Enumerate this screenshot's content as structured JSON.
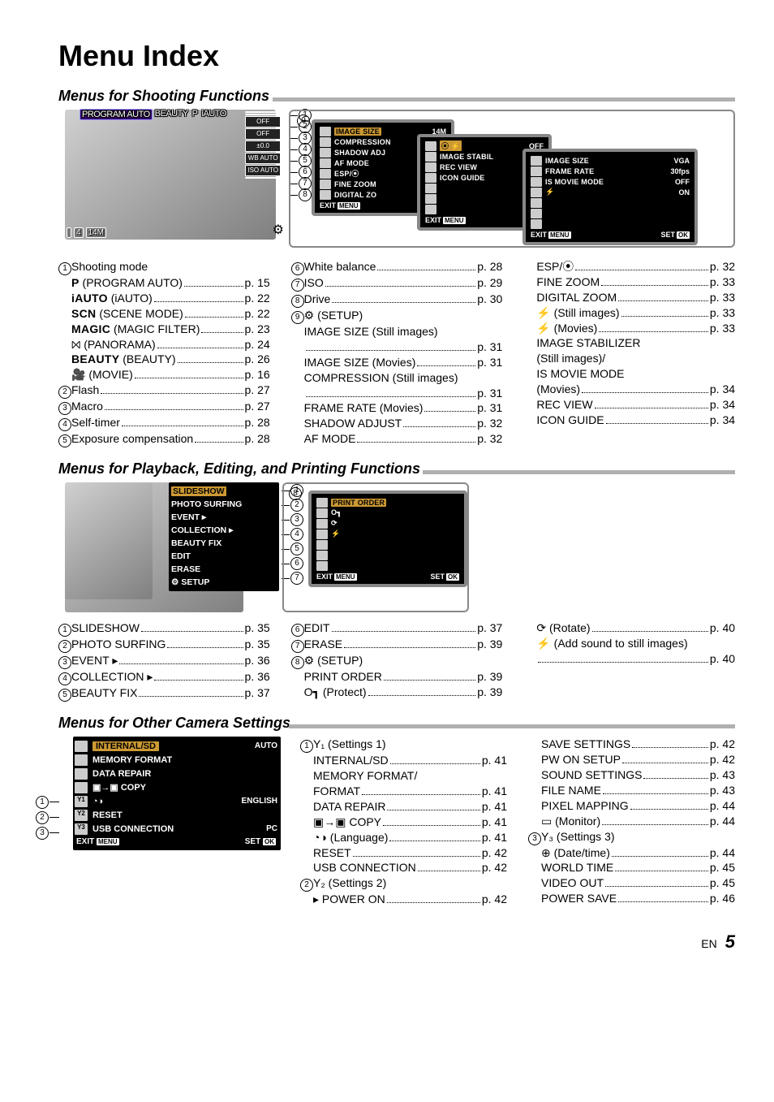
{
  "page": {
    "title": "Menu Index",
    "lang": "EN",
    "number": "5"
  },
  "sec1": {
    "title": "Menus for Shooting Functions",
    "modeBar": [
      "PROGRAM AUTO",
      "BEAUTY",
      "P",
      "iAUTO"
    ],
    "rightChips": [
      "",
      "",
      "OFF",
      "OFF",
      "±0.0",
      "WB AUTO",
      "ISO AUTO",
      ""
    ],
    "bottomChips": [
      "",
      "4",
      "14M"
    ],
    "panels": {
      "p1": {
        "rows": [
          [
            "IMAGE SIZE",
            "14M",
            true
          ],
          [
            "COMPRESSION",
            ""
          ],
          [
            "SHADOW ADJ",
            ""
          ],
          [
            "AF MODE",
            ""
          ],
          [
            "ESP/⦿",
            ""
          ],
          [
            "FINE ZOOM",
            ""
          ],
          [
            "DIGITAL ZO",
            ""
          ]
        ],
        "footL": "EXIT",
        "footLk": "MENU"
      },
      "p2": {
        "rows": [
          [
            "⦿ ⚡",
            "OFF",
            true
          ],
          [
            "IMAGE STABIL",
            ""
          ],
          [
            "REC VIEW",
            ""
          ],
          [
            "ICON GUIDE",
            ""
          ],
          [
            "",
            ""
          ],
          [
            "",
            ""
          ],
          [
            "",
            ""
          ]
        ],
        "footL": "EXIT",
        "footLk": "MENU"
      },
      "p3": {
        "rows": [
          [
            "IMAGE SIZE",
            "VGA"
          ],
          [
            "FRAME RATE",
            "30fps"
          ],
          [
            "IS MOVIE MODE",
            "OFF"
          ],
          [
            "⚡",
            "ON"
          ],
          [
            "",
            ""
          ],
          [
            "",
            ""
          ],
          [
            "",
            ""
          ]
        ],
        "footL": "EXIT",
        "footLk": "MENU",
        "footR": "SET",
        "footRk": "OK"
      }
    },
    "col1": [
      {
        "circ": "1",
        "label": "Shooting mode",
        "noPage": true
      },
      {
        "sub": true,
        "strong": "P",
        "label": " (PROGRAM AUTO)",
        "pg": "p. 15"
      },
      {
        "sub": true,
        "strong": "iAUTO",
        "label": " (iAUTO)",
        "pg": "p. 22"
      },
      {
        "sub": true,
        "strong": "SCN",
        "label": " (SCENE MODE)",
        "pg": "p. 22"
      },
      {
        "sub": true,
        "strong": "MAGIC",
        "label": " (MAGIC FILTER)",
        "pg": "p. 23"
      },
      {
        "sub": true,
        "label": "⨝ (PANORAMA)",
        "pg": "p. 24"
      },
      {
        "sub": true,
        "strong": "BEAUTY",
        "label": " (BEAUTY)",
        "pg": "p. 26"
      },
      {
        "sub": true,
        "label": "🎥 (MOVIE)",
        "pg": "p. 16"
      },
      {
        "circ": "2",
        "label": "Flash",
        "pg": "p. 27"
      },
      {
        "circ": "3",
        "label": "Macro",
        "pg": "p. 27"
      },
      {
        "circ": "4",
        "label": "Self-timer",
        "pg": "p. 28"
      },
      {
        "circ": "5",
        "label": "Exposure compensation",
        "pg": "p. 28"
      }
    ],
    "col2": [
      {
        "circ": "6",
        "label": "White balance",
        "pg": "p. 28"
      },
      {
        "circ": "7",
        "label": "ISO",
        "pg": "p. 29"
      },
      {
        "circ": "8",
        "label": "Drive",
        "pg": "p. 30"
      },
      {
        "circ": "9",
        "label": "⚙ (SETUP)",
        "noPage": true
      },
      {
        "sub": true,
        "label": "IMAGE SIZE (Still images)",
        "noPage": true
      },
      {
        "sub": true,
        "label": "",
        "pg": "p. 31"
      },
      {
        "sub": true,
        "label": "IMAGE SIZE (Movies)",
        "pg": "p. 31"
      },
      {
        "sub": true,
        "label": "COMPRESSION (Still images)",
        "noPage": true
      },
      {
        "sub": true,
        "label": "",
        "pg": "p. 31"
      },
      {
        "sub": true,
        "label": "FRAME RATE (Movies)",
        "pg": "p. 31"
      },
      {
        "sub": true,
        "label": "SHADOW ADJUST",
        "pg": "p. 32"
      },
      {
        "sub": true,
        "label": "AF MODE",
        "pg": "p. 32"
      }
    ],
    "col3": [
      {
        "sub": true,
        "label": "ESP/⦿",
        "pg": "p. 32"
      },
      {
        "sub": true,
        "label": "FINE ZOOM",
        "pg": "p. 33"
      },
      {
        "sub": true,
        "label": "DIGITAL ZOOM",
        "pg": "p. 33"
      },
      {
        "sub": true,
        "label": "⚡ (Still images)",
        "pg": "p. 33"
      },
      {
        "sub": true,
        "label": "⚡ (Movies)",
        "pg": "p. 33"
      },
      {
        "sub": true,
        "label": "IMAGE STABILIZER",
        "noPage": true
      },
      {
        "sub": true,
        "label": "(Still images)/",
        "noPage": true
      },
      {
        "sub": true,
        "label": "IS MOVIE MODE",
        "noPage": true
      },
      {
        "sub": true,
        "label": "(Movies)",
        "pg": "p. 34"
      },
      {
        "sub": true,
        "label": "REC VIEW",
        "pg": "p. 34"
      },
      {
        "sub": true,
        "label": "ICON GUIDE",
        "pg": "p. 34"
      }
    ]
  },
  "sec2": {
    "title": "Menus for Playback, Editing, and Printing Functions",
    "overlay": [
      [
        "SLIDESHOW",
        true
      ],
      [
        "PHOTO SURFING"
      ],
      [
        "EVENT ▸"
      ],
      [
        "COLLECTION ▸"
      ],
      [
        "BEAUTY FIX"
      ],
      [
        "EDIT"
      ],
      [
        "ERASE"
      ],
      [
        "⚙ SETUP"
      ]
    ],
    "panel": {
      "rows": [
        [
          "PRINT ORDER",
          true
        ],
        [
          "O┓"
        ],
        [
          "⟳"
        ],
        [
          "⚡"
        ],
        [
          ""
        ],
        [
          ""
        ],
        [
          ""
        ]
      ],
      "footL": "EXIT",
      "footLk": "MENU",
      "footR": "SET",
      "footRk": "OK"
    },
    "col1": [
      {
        "circ": "1",
        "label": "SLIDESHOW",
        "pg": "p. 35"
      },
      {
        "circ": "2",
        "label": "PHOTO SURFING",
        "pg": "p. 35"
      },
      {
        "circ": "3",
        "label": "EVENT ▸",
        "pg": "p. 36"
      },
      {
        "circ": "4",
        "label": "COLLECTION ▸",
        "pg": "p. 36"
      },
      {
        "circ": "5",
        "label": "BEAUTY FIX",
        "pg": "p. 37"
      }
    ],
    "col2": [
      {
        "circ": "6",
        "label": "EDIT",
        "pg": "p. 37"
      },
      {
        "circ": "7",
        "label": "ERASE",
        "pg": "p. 39"
      },
      {
        "circ": "8",
        "label": "⚙ (SETUP)",
        "noPage": true
      },
      {
        "sub": true,
        "label": "PRINT ORDER",
        "pg": "p. 39"
      },
      {
        "sub": true,
        "label": "O┓ (Protect)",
        "pg": "p. 39"
      }
    ],
    "col3": [
      {
        "sub": true,
        "label": "⟳ (Rotate)",
        "pg": "p. 40"
      },
      {
        "sub": true,
        "label": "⚡ (Add sound to still images)",
        "noPage": true
      },
      {
        "sub": true,
        "label": "",
        "pg": "p. 40"
      }
    ]
  },
  "sec3": {
    "title": "Menus for Other Camera Settings",
    "panel": {
      "rows": [
        [
          "",
          "INTERNAL/SD",
          "AUTO",
          true
        ],
        [
          "",
          "MEMORY FORMAT",
          ""
        ],
        [
          "",
          "DATA REPAIR",
          ""
        ],
        [
          "",
          "▣→▣ COPY",
          ""
        ],
        [
          "Y1",
          "◔◑",
          "ENGLISH"
        ],
        [
          "Y2",
          "RESET",
          ""
        ],
        [
          "Y3",
          "USB CONNECTION",
          "PC"
        ]
      ],
      "footL": "EXIT",
      "footLk": "MENU",
      "footR": "SET",
      "footRk": "OK"
    },
    "col1": [
      {
        "circ": "1",
        "label": "Y₁ (Settings 1)",
        "noPage": true
      },
      {
        "sub": true,
        "label": "INTERNAL/SD",
        "pg": "p. 41"
      },
      {
        "sub": true,
        "label": "MEMORY FORMAT/",
        "noPage": true
      },
      {
        "sub": true,
        "label": "FORMAT",
        "pg": "p. 41"
      },
      {
        "sub": true,
        "label": "DATA REPAIR",
        "pg": "p. 41"
      },
      {
        "sub": true,
        "label": "▣→▣ COPY",
        "pg": "p. 41"
      },
      {
        "sub": true,
        "label": "◔◑ (Language)",
        "pg": "p. 41"
      },
      {
        "sub": true,
        "label": "RESET",
        "pg": "p. 42"
      },
      {
        "sub": true,
        "label": "USB CONNECTION",
        "pg": "p. 42"
      },
      {
        "circ": "2",
        "label": "Y₂ (Settings 2)",
        "noPage": true
      },
      {
        "sub": true,
        "label": "▸ POWER ON",
        "pg": "p. 42"
      }
    ],
    "col2": [
      {
        "sub": true,
        "label": "SAVE SETTINGS",
        "pg": "p. 42"
      },
      {
        "sub": true,
        "label": "PW ON SETUP",
        "pg": "p. 42"
      },
      {
        "sub": true,
        "label": "SOUND SETTINGS",
        "pg": "p. 43"
      },
      {
        "sub": true,
        "label": "FILE NAME",
        "pg": "p. 43"
      },
      {
        "sub": true,
        "label": "PIXEL MAPPING",
        "pg": "p. 44"
      },
      {
        "sub": true,
        "label": "▭ (Monitor)",
        "pg": "p. 44"
      },
      {
        "circ": "3",
        "label": "Y₃ (Settings 3)",
        "noPage": true
      },
      {
        "sub": true,
        "label": "⊕ (Date/time)",
        "pg": "p. 44"
      },
      {
        "sub": true,
        "label": "WORLD TIME",
        "pg": "p. 45"
      },
      {
        "sub": true,
        "label": "VIDEO OUT",
        "pg": "p. 45"
      },
      {
        "sub": true,
        "label": "POWER SAVE",
        "pg": "p. 46"
      }
    ]
  }
}
